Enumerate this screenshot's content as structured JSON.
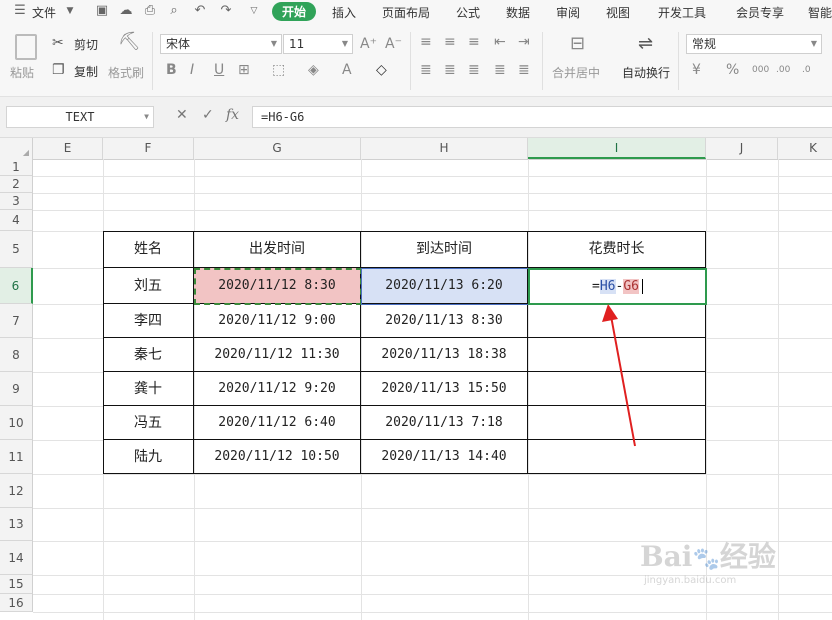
{
  "menu": {
    "file_label": "文件",
    "tabs": [
      "开始",
      "插入",
      "页面布局",
      "公式",
      "数据",
      "审阅",
      "视图",
      "开发工具",
      "会员专享",
      "智能"
    ],
    "active_tab": "开始"
  },
  "ribbon": {
    "paste_label": "粘贴",
    "cut_label": "剪切",
    "copy_label": "复制",
    "format_painter_label": "格式刷",
    "font_name": "宋体",
    "font_size": "11",
    "merge_center_label": "合并居中",
    "wrap_text_label": "自动换行",
    "number_format": "常规"
  },
  "formula_bar": {
    "name_box": "TEXT",
    "fx_label": "fx",
    "formula": "=H6-G6"
  },
  "columns": [
    "E",
    "F",
    "G",
    "H",
    "I",
    "J",
    "K"
  ],
  "selected_column": "I",
  "rows": [
    "1",
    "2",
    "3",
    "4",
    "5",
    "6",
    "7",
    "8",
    "9",
    "10",
    "11",
    "12",
    "13",
    "14",
    "15",
    "16"
  ],
  "selected_row": "6",
  "table": {
    "headers": [
      "姓名",
      "出发时间",
      "到达时间",
      "花费时长"
    ],
    "data": [
      [
        "刘五",
        "2020/11/12 8:30",
        "2020/11/13 6:20"
      ],
      [
        "李四",
        "2020/11/12 9:00",
        "2020/11/13 8:30"
      ],
      [
        "秦七",
        "2020/11/12 11:30",
        "2020/11/13 18:38"
      ],
      [
        "龚十",
        "2020/11/12 9:20",
        "2020/11/13 15:50"
      ],
      [
        "冯五",
        "2020/11/12 6:40",
        "2020/11/13 7:18"
      ],
      [
        "陆九",
        "2020/11/12 10:50",
        "2020/11/13 14:40"
      ]
    ],
    "editing_cell": {
      "eq": "=",
      "ref1": "H6",
      "op": "-",
      "ref2": "G6"
    }
  },
  "colors": {
    "accent_green": "#30a359",
    "ref_g6_fill": "#f2c4c4",
    "ref_h6_fill": "#d7e1f5",
    "arrow_red": "#e02020"
  },
  "watermark": "Baidu经验 jingyan.baidu.com"
}
